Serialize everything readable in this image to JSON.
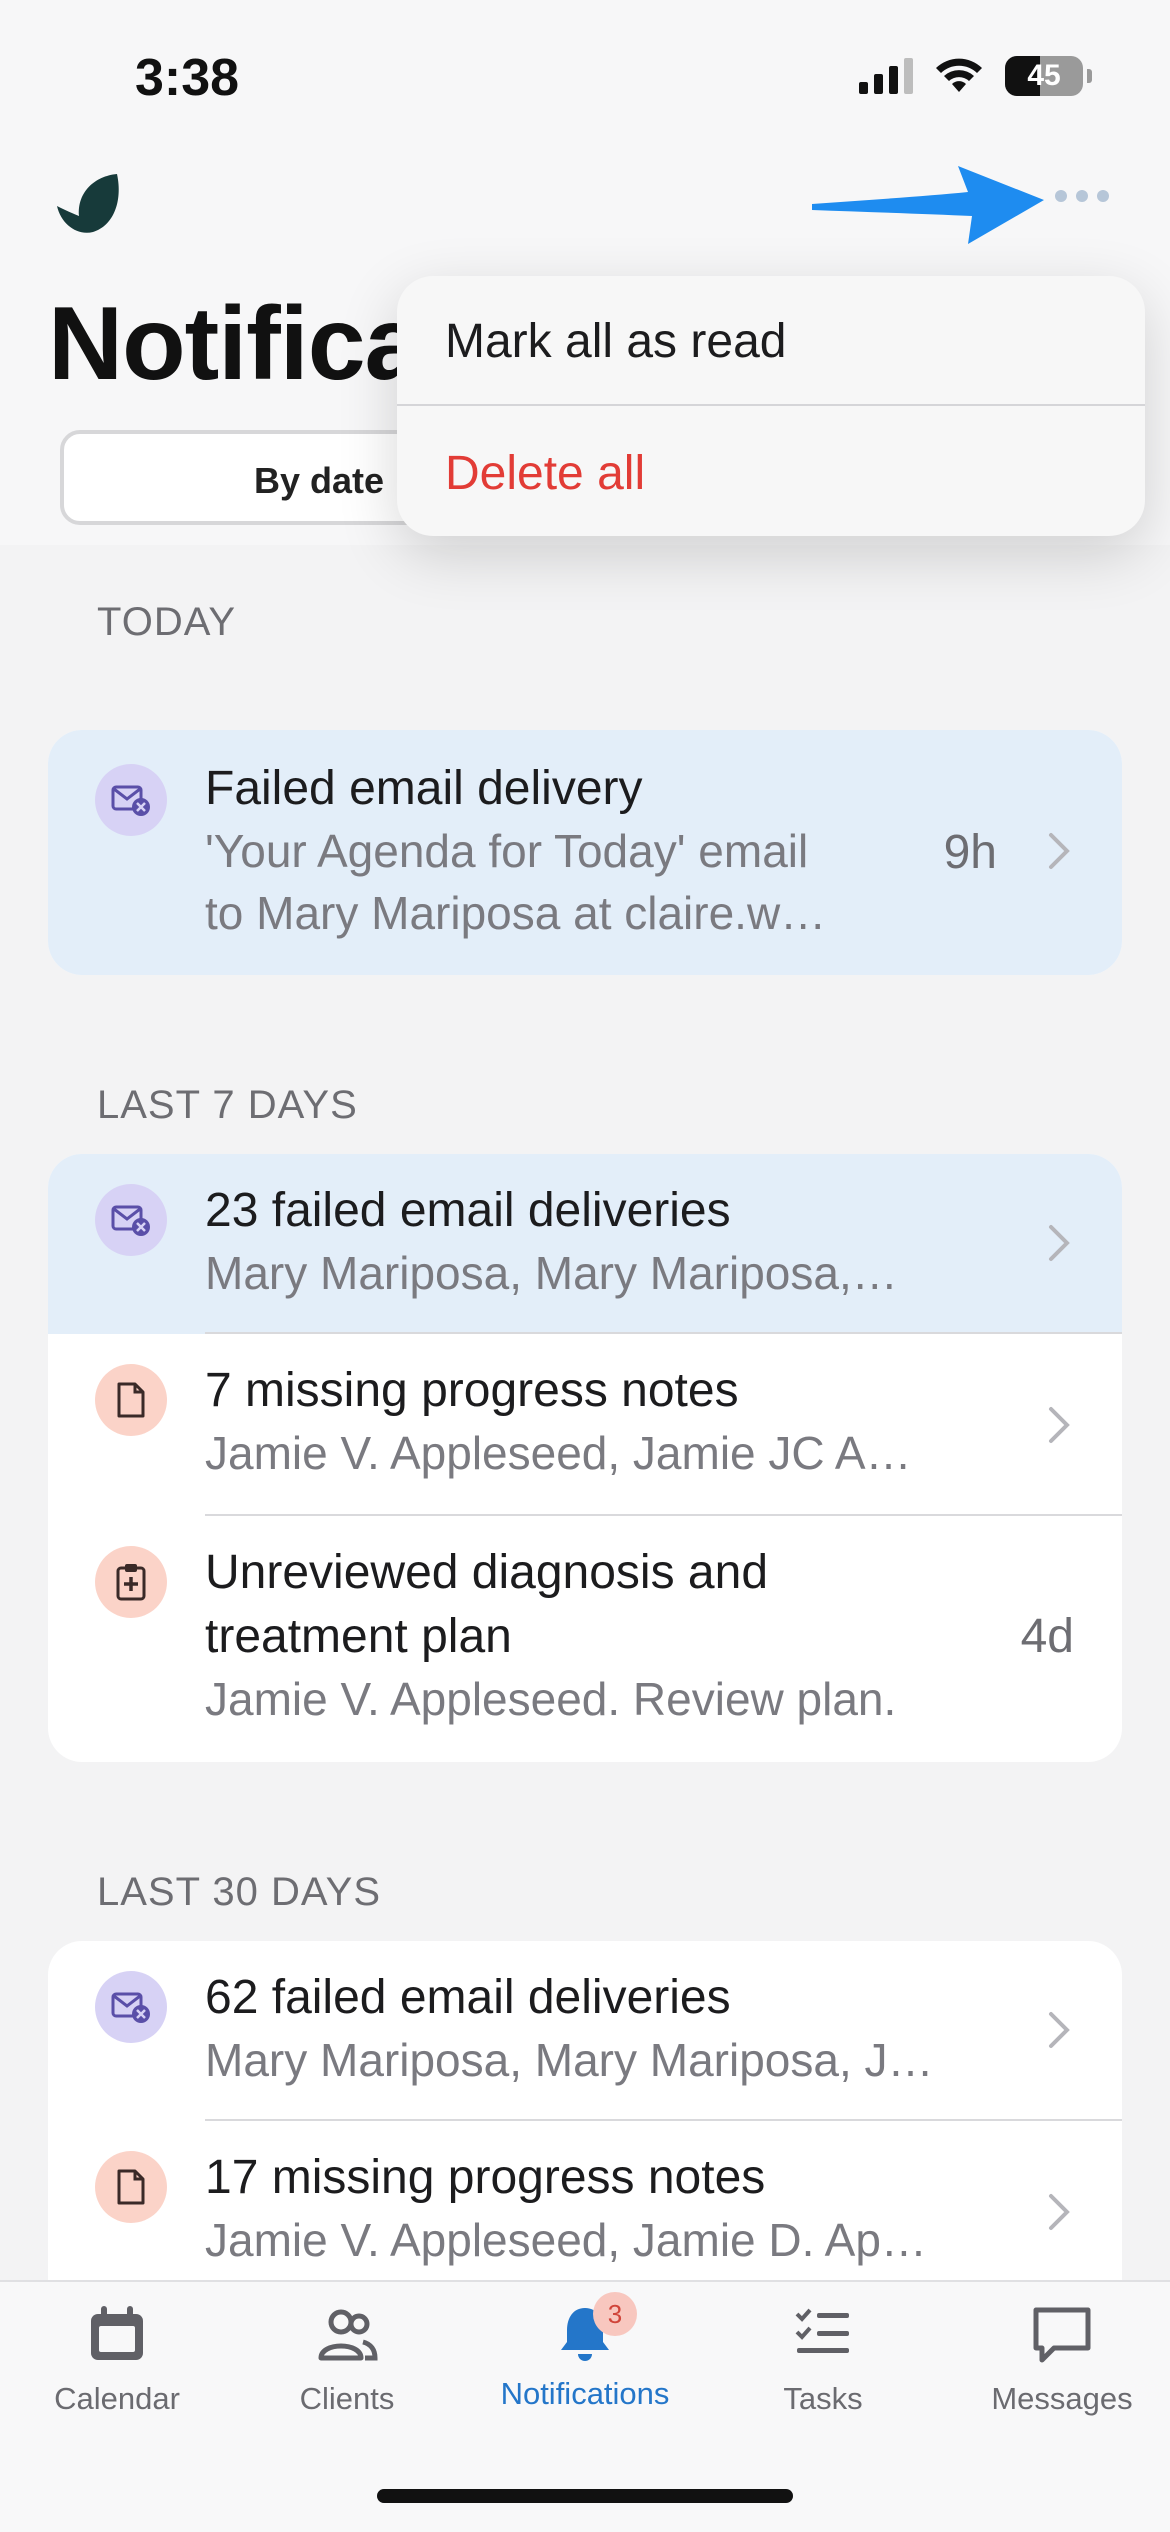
{
  "status_bar": {
    "time": "3:38",
    "battery": "45"
  },
  "header": {
    "title": "Notifica",
    "segment_selected": "By date"
  },
  "menu": {
    "mark_all_read": "Mark all as read",
    "delete_all": "Delete all"
  },
  "sections": [
    {
      "label": "TODAY",
      "items": [
        {
          "title": "Failed email delivery",
          "subtitle_line1": "'Your Agenda for Today' email",
          "subtitle_line2": "to Mary Mariposa at claire.w…",
          "time": "9h",
          "icon": "failed-email-icon",
          "unread": true
        }
      ]
    },
    {
      "label": "LAST 7 DAYS",
      "items": [
        {
          "title": "23 failed email deliveries",
          "subtitle": "Mary Mariposa, Mary Mariposa,…",
          "icon": "failed-email-icon",
          "unread": true
        },
        {
          "title": "7 missing progress notes",
          "subtitle": "Jamie V. Appleseed, Jamie JC A…",
          "icon": "document-icon",
          "unread": false
        },
        {
          "title_line1": "Unreviewed diagnosis and",
          "title_line2": "treatment plan",
          "subtitle": "Jamie V. Appleseed. Review plan.",
          "time": "4d",
          "icon": "clipboard-plus-icon",
          "unread": false
        }
      ]
    },
    {
      "label": "LAST 30 DAYS",
      "items": [
        {
          "title": "62 failed email deliveries",
          "subtitle": "Mary Mariposa, Mary Mariposa, J…",
          "icon": "failed-email-icon",
          "unread": false
        },
        {
          "title": "17 missing progress notes",
          "subtitle": "Jamie V. Appleseed, Jamie D. Ap…",
          "icon": "document-icon",
          "unread": false
        }
      ]
    }
  ],
  "tabbar": {
    "tabs": [
      {
        "label": "Calendar",
        "icon": "calendar-icon"
      },
      {
        "label": "Clients",
        "icon": "clients-icon"
      },
      {
        "label": "Notifications",
        "icon": "bell-icon",
        "badge": "3",
        "active": true
      },
      {
        "label": "Tasks",
        "icon": "tasks-icon"
      },
      {
        "label": "Messages",
        "icon": "message-icon"
      }
    ]
  },
  "colors": {
    "accent": "#2476c9",
    "danger": "#e23c36",
    "unread_bg": "#e3eef9",
    "annotation_arrow": "#1e8cf0"
  }
}
